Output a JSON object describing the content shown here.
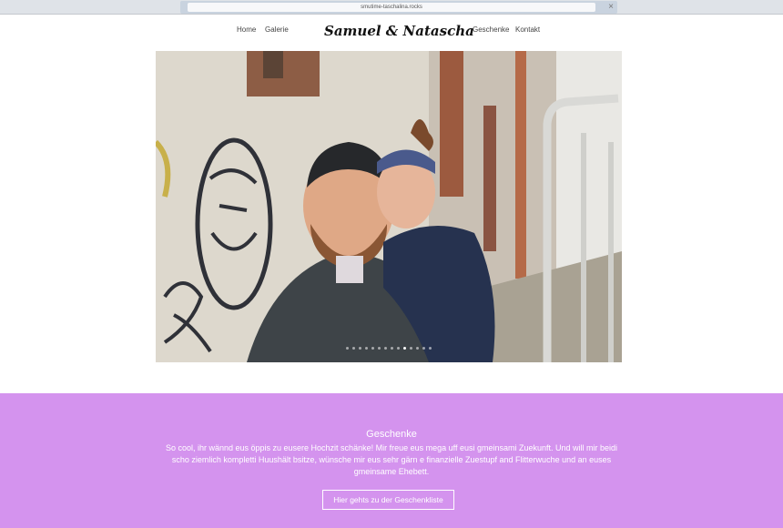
{
  "browser": {
    "url": "smutime-taschalina.rocks"
  },
  "nav": {
    "brand": "Samuel & Natascha",
    "links": {
      "home": "Home",
      "gallery": "Galerie",
      "gifts": "Geschenke",
      "contact": "Kontakt"
    }
  },
  "hero": {
    "slide_count": 14,
    "active_slide": 9
  },
  "gifts": {
    "title": "Geschenke",
    "text": "So cool, ihr wännd eus öppis zu eusere Hochzit schänke! Mir freue eus mega uff eusi gmeinsami Zuekunft. Und will mir beidi scho ziemlich kompletti Huushält bsitze, wünsche mir eus sehr gärn e finanzielle Zuestupf and Flitterwuche und an euses gmeinsame Ehebett.",
    "button_label": "Hier gehts zu der Geschenkliste"
  },
  "colors": {
    "accent": "#d493ee",
    "chrome": "#dfe3e8"
  }
}
